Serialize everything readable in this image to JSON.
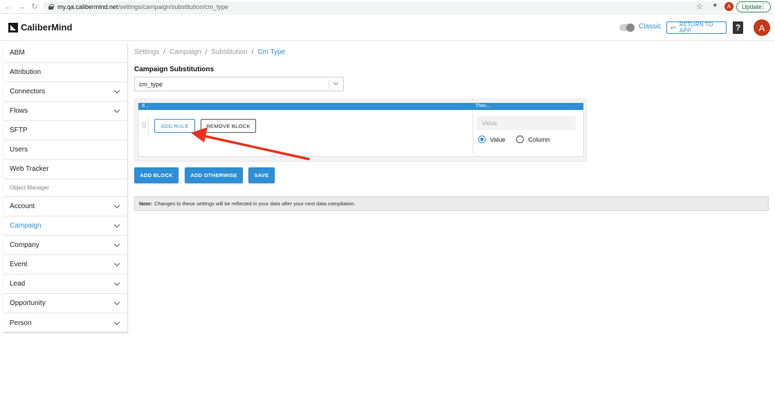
{
  "browser": {
    "url_host": "my.qa.calibermind.net",
    "url_path": "/settings/campaign/substitution/cm_type",
    "profile_initial": "A",
    "update_label": "Update"
  },
  "header": {
    "logo_text": "CaliberMind",
    "classic_label": "Classic",
    "return_label": "RETURN TO APP",
    "help_label": "?",
    "avatar_initial": "A"
  },
  "sidebar": {
    "items": [
      {
        "label": "ABM",
        "chevron": false
      },
      {
        "label": "Attribution",
        "chevron": false
      },
      {
        "label": "Connectors",
        "chevron": true
      },
      {
        "label": "Flows",
        "chevron": true
      },
      {
        "label": "SFTP",
        "chevron": false
      },
      {
        "label": "Users",
        "chevron": false
      },
      {
        "label": "Web Tracker",
        "chevron": false
      }
    ],
    "section_label": "Object Manager",
    "objects": [
      {
        "label": "Account",
        "active": false
      },
      {
        "label": "Campaign",
        "active": true
      },
      {
        "label": "Company",
        "active": false
      },
      {
        "label": "Event",
        "active": false
      },
      {
        "label": "Lead",
        "active": false
      },
      {
        "label": "Opportunity",
        "active": false
      },
      {
        "label": "Person",
        "active": false
      }
    ]
  },
  "breadcrumb": [
    "Settings",
    "Campaign",
    "Substitution",
    "Cm Type"
  ],
  "main": {
    "title": "Campaign Substitutions",
    "select_value": "cm_type",
    "block": {
      "if_label": "If...",
      "then_label": "Then...",
      "add_rule_label": "ADD RULE",
      "remove_block_label": "REMOVE BLOCK",
      "value_placeholder": "Value",
      "radio_value_label": "Value",
      "radio_column_label": "Column",
      "selected_radio": "Value"
    },
    "add_block_label": "ADD BLOCK",
    "add_otherwise_label": "ADD OTHERWISE",
    "save_label": "SAVE",
    "note_bold": "Note:",
    "note_text": "Changes to these settings will be reflected in your data after your next data compilation."
  },
  "colors": {
    "accent": "#2d8fd5",
    "annotation_arrow": "#e8321e",
    "avatar": "#c5391a"
  }
}
